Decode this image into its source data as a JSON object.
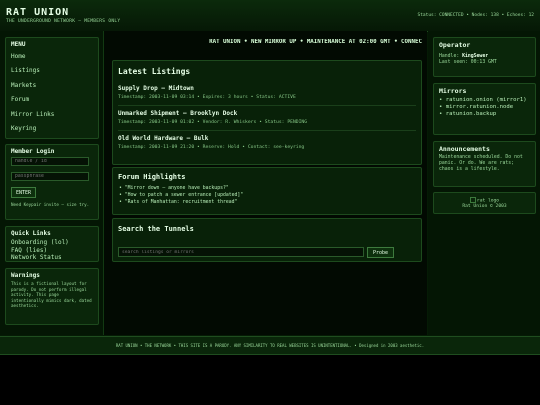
{
  "header": {
    "title": "RAT UNION",
    "subtitle": "THE UNDERGROUND NETWORK — MEMBERS ONLY",
    "status": "Status: CONNECTED • Nodes: 138 • Echoes: 12"
  },
  "menu": {
    "title": "MENU",
    "items": [
      "Home",
      "Listings",
      "Markets",
      "Forum",
      "Mirror Links",
      "Keyring"
    ]
  },
  "login": {
    "title": "Member Login",
    "handle_placeholder": "handle / id",
    "passphrase_placeholder": "passphrase",
    "enter_label": "ENTER",
    "note": "Need Keypair invite — size try."
  },
  "quick_links": {
    "title": "Quick Links",
    "items": [
      "Onboarding (lol)",
      "FAQ (lies)",
      "Network Status"
    ]
  },
  "warnings": {
    "title": "Warnings",
    "text": "This is a fictional layout for parody. Do not perform illegal activity. This page intentionally mimics dark, dated aesthetics."
  },
  "marquee": "RAT UNION • NEW MIRROR UP • MAINTENANCE AT 02:00 GMT • CONNEC",
  "listings": {
    "title": "Latest Listings",
    "items": [
      {
        "title": "Supply Drop — Midtown",
        "meta": "Timestamp: 2003-11-09 03:14 • Expires: 3 hours • Status: ACTIVE"
      },
      {
        "title": "Unmarked Shipment — Brooklyn Dock",
        "meta": "Timestamp: 2003-11-09 01:02 • Vendor: R. Whiskers • Status: PENDING"
      },
      {
        "title": "Old World Hardware — Bulk",
        "meta": "Timestamp: 2003-11-09 21:20 • Reserve: Hold • Contact: see-keyring"
      }
    ]
  },
  "forum": {
    "title": "Forum Highlights",
    "items": [
      "• \"Mirror down — anyone have backups?\"",
      "• \"How to patch a sewer entrance [updated]\"",
      "• \"Rats of Manhattan: recruitment thread\""
    ]
  },
  "search": {
    "title": "Search the Tunnels",
    "placeholder": "search listings or mirrors",
    "button_label": "Probe"
  },
  "operator": {
    "title": "Operator",
    "handle_label": "Handle:",
    "handle_value": "KingSewer",
    "last_seen": "Last seen: 00:13 GMT"
  },
  "mirrors": {
    "title": "Mirrors",
    "items": [
      "• ratunion.onion (mirror1)",
      "• mirror.ratunion.node",
      "• ratunion.backup"
    ]
  },
  "announcements": {
    "title": "Announcements",
    "text": "Maintenance scheduled. Do not panic. Or do. We are rats; chaos is a lifestyle."
  },
  "logo": {
    "alt": "rat logo",
    "caption": "Rat Union © 2003"
  },
  "footer": {
    "text": "RAT UNION • THE NETWORK • THIS SITE IS A PARODY. ANY SIMILARITY TO REAL WEBSITES IS UNINTENTIONAL. • Designed in 2003 aesthetic."
  },
  "colors": {
    "background": "#051b05",
    "text": "#b9f0b9",
    "accent": "#e6ffe6",
    "border": "#1d4a1d"
  }
}
